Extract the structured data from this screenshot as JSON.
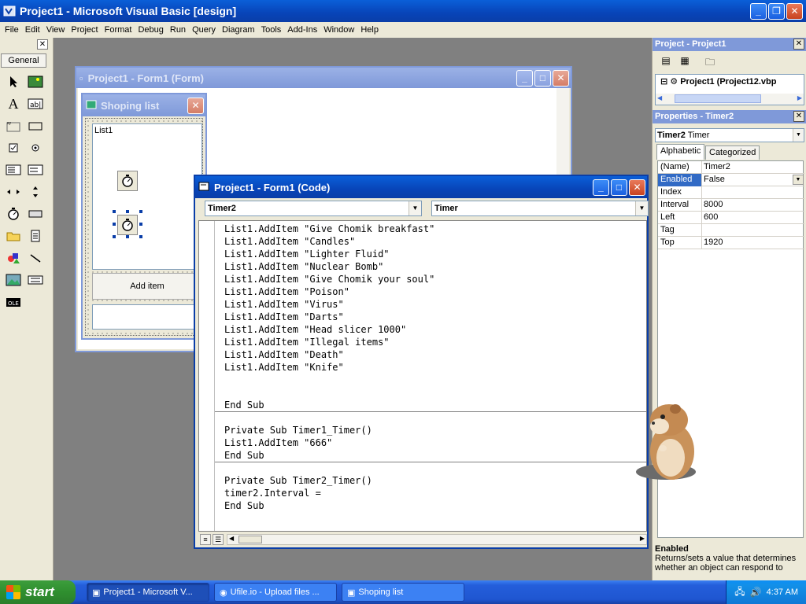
{
  "app": {
    "title": "Project1 - Microsoft Visual Basic [design]"
  },
  "menu": [
    "File",
    "Edit",
    "View",
    "Project",
    "Format",
    "Debug",
    "Run",
    "Query",
    "Diagram",
    "Tools",
    "Add-Ins",
    "Window",
    "Help"
  ],
  "toolbox": {
    "tab_label": "General",
    "tools": [
      "pointer-icon",
      "picture-box-icon",
      "label-icon",
      "text-box-icon",
      "frame-icon",
      "command-button-icon",
      "check-box-icon",
      "option-button-icon",
      "combo-box-icon",
      "list-box-icon",
      "hscroll-icon",
      "vscroll-icon",
      "timer-icon",
      "drive-list-icon",
      "dir-list-icon",
      "file-list-icon",
      "shape-icon",
      "line-icon",
      "image-icon",
      "data-icon",
      "ole-icon"
    ]
  },
  "form_window": {
    "title": "Project1 - Form1 (Form)"
  },
  "shop_form": {
    "title": "Shoping list",
    "list_label": "List1",
    "button_label": "Add item"
  },
  "code_window": {
    "title": "Project1 - Form1 (Code)",
    "object_combo": "Timer2",
    "proc_combo": "Timer",
    "lines": [
      "List1.AddItem \"Give Chomik breakfast\"",
      "List1.AddItem \"Candles\"",
      "List1.AddItem \"Lighter Fluid\"",
      "List1.AddItem \"Nuclear Bomb\"",
      "List1.AddItem \"Give Chomik your soul\"",
      "List1.AddItem \"Poison\"",
      "List1.AddItem \"Virus\"",
      "List1.AddItem \"Darts\"",
      "List1.AddItem \"Head slicer 1000\"",
      "List1.AddItem \"Illegal items\"",
      "List1.AddItem \"Death\"",
      "List1.AddItem \"Knife\"",
      "",
      "",
      "End Sub",
      "",
      "Private Sub Timer1_Timer()",
      "List1.AddItem \"666\"",
      "End Sub",
      "",
      "Private Sub Timer2_Timer()",
      "timer2.Interval =",
      "End Sub"
    ]
  },
  "project_panel": {
    "title": "Project - Project1",
    "tree_root": "Project1 (Project12.vbp"
  },
  "properties_panel": {
    "title": "Properties - Timer2",
    "object_name": "Timer2",
    "object_type": "Timer",
    "tabs": [
      "Alphabetic",
      "Categorized"
    ],
    "rows": [
      {
        "name": "(Name)",
        "value": "Timer2"
      },
      {
        "name": "Enabled",
        "value": "False"
      },
      {
        "name": "Index",
        "value": ""
      },
      {
        "name": "Interval",
        "value": "8000"
      },
      {
        "name": "Left",
        "value": "600"
      },
      {
        "name": "Tag",
        "value": ""
      },
      {
        "name": "Top",
        "value": "1920"
      }
    ],
    "selected_row": "Enabled",
    "description_name": "Enabled",
    "description_text": "Returns/sets a value that determines whether an object can respond to"
  },
  "taskbar": {
    "start_label": "start",
    "tasks": [
      "Project1 - Microsoft V...",
      "Ufile.io - Upload files ...",
      "Shoping list"
    ],
    "clock": "4:37 AM"
  }
}
